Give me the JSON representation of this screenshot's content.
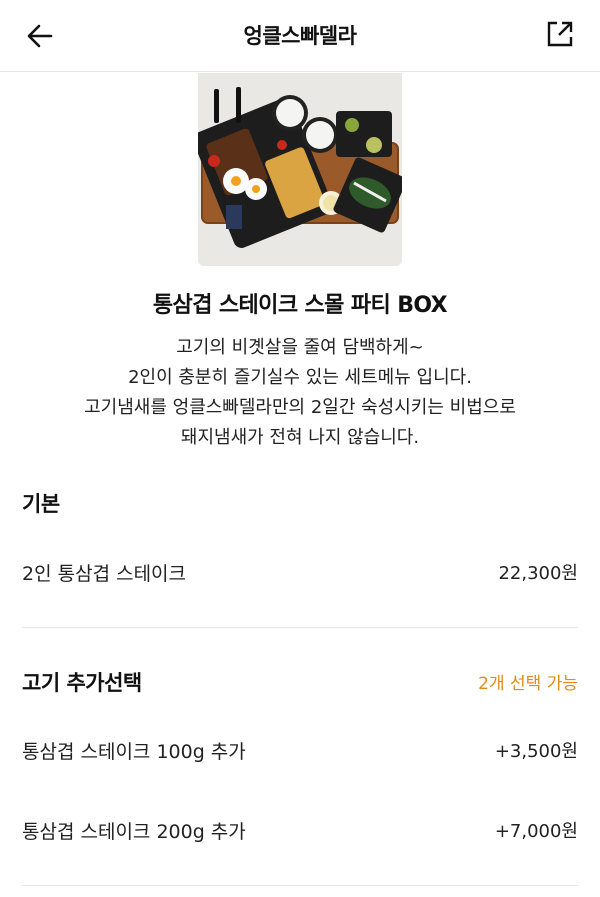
{
  "header": {
    "title": "엉클스빠델라",
    "back_icon": "arrow-left-icon",
    "share_icon": "share-external-icon"
  },
  "product": {
    "name": "통삼겹 스테이크 스몰 파티 BOX",
    "description": [
      "고기의 비곗살을 줄여 담백하게~",
      "2인이 충분히 즐기실수 있는 세트메뉴 입니다.",
      "고기냄새를 엉클스빠델라만의 2일간 숙성시키는 비법으로",
      "돼지냄새가 전혀 나지 않습니다."
    ]
  },
  "sections": [
    {
      "title": "기본",
      "note": "",
      "items": [
        {
          "label": "2인 통삼겹 스테이크",
          "price": "22,300원"
        }
      ]
    },
    {
      "title": "고기 추가선택",
      "note": "2개 선택 가능",
      "items": [
        {
          "label": "통삼겹 스테이크 100g 추가",
          "price": "+3,500원"
        },
        {
          "label": "통삼겹 스테이크 200g 추가",
          "price": "+7,000원"
        }
      ]
    }
  ],
  "colors": {
    "accent": "#e38b1a",
    "divider": "#e6e6e6"
  }
}
